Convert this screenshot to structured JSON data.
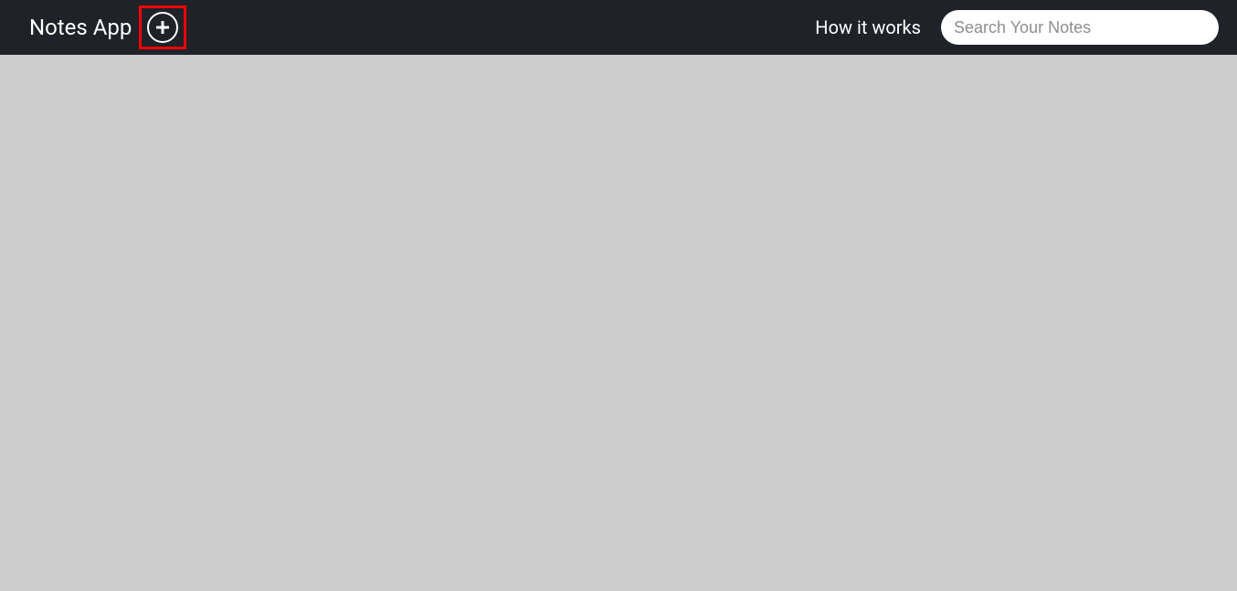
{
  "header": {
    "title": "Notes App",
    "how_it_works_label": "How it works",
    "search": {
      "placeholder": "Search Your Notes",
      "value": ""
    }
  }
}
